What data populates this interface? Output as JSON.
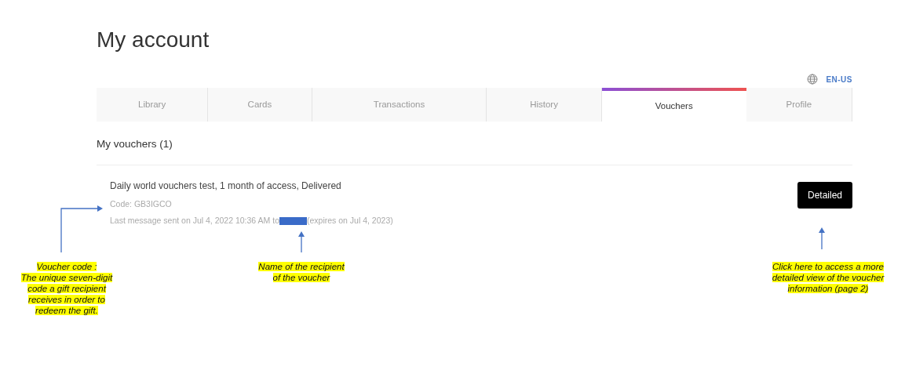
{
  "page_title": "My account",
  "language": "EN-US",
  "tabs": [
    {
      "label": "Library",
      "selected": false
    },
    {
      "label": "Cards",
      "selected": false
    },
    {
      "label": "Transactions",
      "selected": false
    },
    {
      "label": "History",
      "selected": false
    },
    {
      "label": "Vouchers",
      "selected": true
    },
    {
      "label": "Profile",
      "selected": false
    }
  ],
  "section_title": "My vouchers (1)",
  "voucher": {
    "title": "Daily world vouchers test, 1 month of access, Delivered",
    "code": "Code: GB3IGCO",
    "message_prefix": "Last message sent on Jul 4, 2022 10:36 AM to",
    "recipient_redacted": true,
    "message_suffix": "(expires on Jul 4, 2023)",
    "button": "Detailed"
  },
  "annotations": [
    {
      "kind": "code",
      "lines": [
        "Voucher code :",
        "The unique seven-digit",
        "code a gift recipient",
        "receives in order to",
        "redeem the gift."
      ]
    },
    {
      "kind": "recipient",
      "lines": [
        "Name of the recipient",
        "of the voucher"
      ]
    },
    {
      "kind": "button",
      "lines": [
        "Click here to access a more",
        "detailed view of the voucher",
        "information (page 2)"
      ]
    }
  ]
}
